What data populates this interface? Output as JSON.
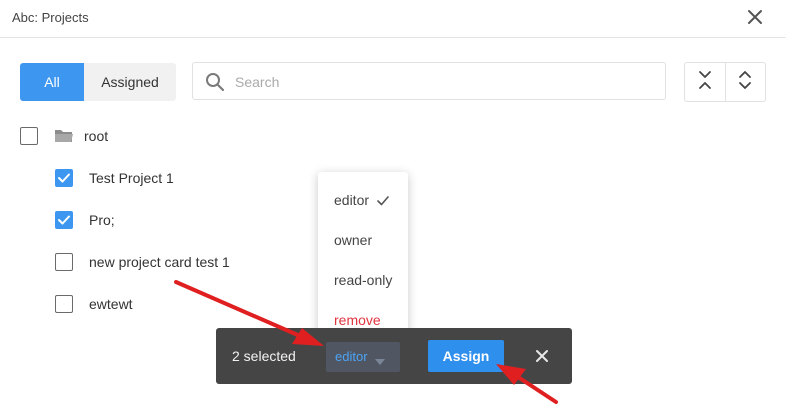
{
  "window": {
    "title": "Abc: Projects"
  },
  "filter": {
    "all_label": "All",
    "assigned_label": "Assigned"
  },
  "search": {
    "placeholder": "Search",
    "value": ""
  },
  "tree": {
    "root": {
      "label": "root",
      "checked": false
    },
    "items": [
      {
        "label": "Test Project 1",
        "checked": true
      },
      {
        "label": "Pro;",
        "checked": true
      },
      {
        "label": "new project card test 1",
        "checked": false
      },
      {
        "label": "ewtewt",
        "checked": false
      }
    ]
  },
  "role_menu": {
    "options": [
      {
        "label": "editor",
        "selected": true
      },
      {
        "label": "owner",
        "selected": false
      },
      {
        "label": "read-only",
        "selected": false
      },
      {
        "label": "remove",
        "selected": false,
        "danger": true
      }
    ]
  },
  "action_bar": {
    "selected_text": "2 selected",
    "role_value": "editor",
    "assign_label": "Assign"
  },
  "colors": {
    "accent": "#3d97f0",
    "danger": "#e0353f",
    "annotation_arrow": "#e02020",
    "action_bar_bg": "#454545"
  },
  "icons": {
    "close": "close-icon",
    "search": "search-icon",
    "collapse_all": "collapse-all-icon",
    "expand_all": "expand-all-icon",
    "folder": "folder-icon",
    "check": "check-icon",
    "caret": "caret-down-icon"
  }
}
